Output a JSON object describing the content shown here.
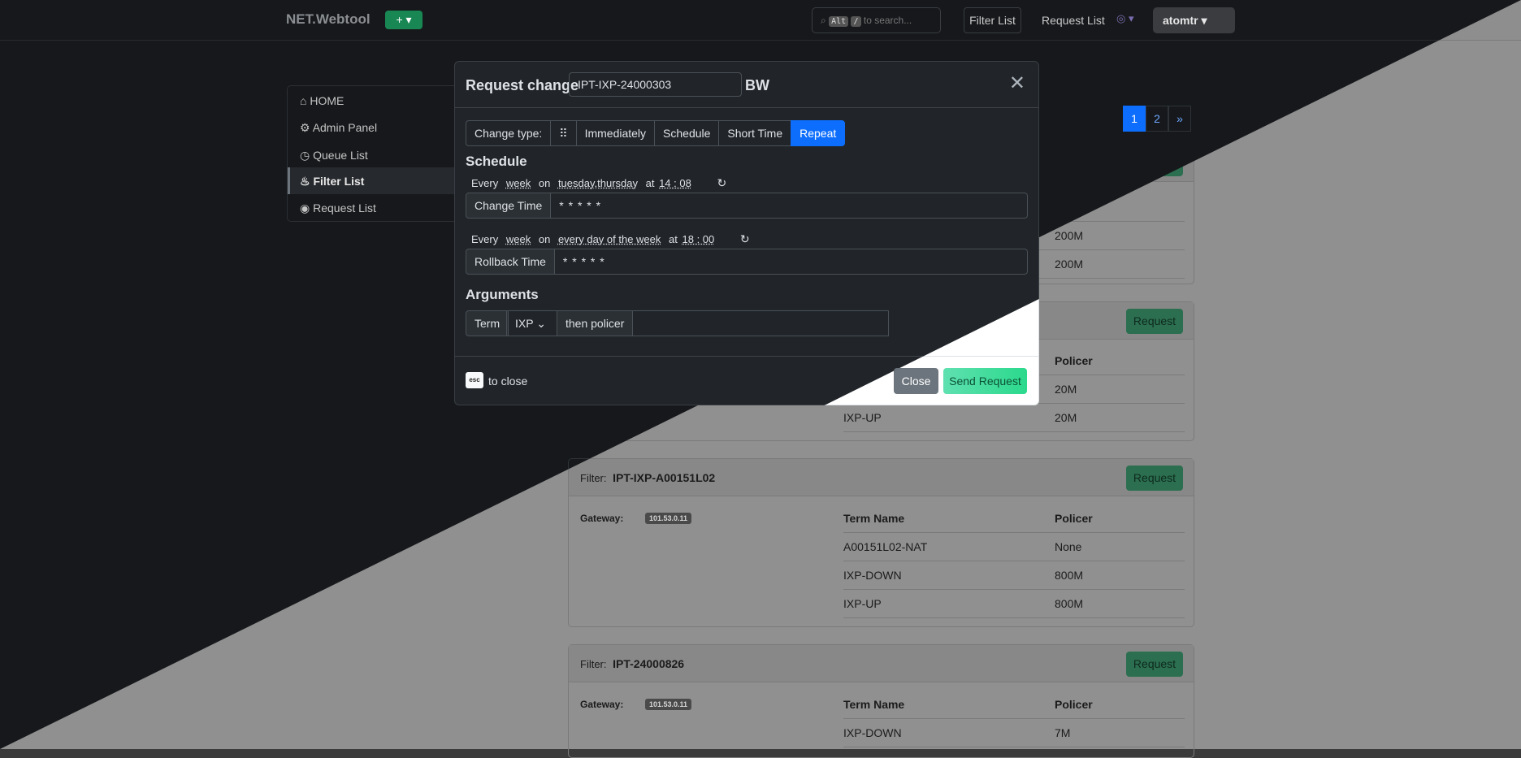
{
  "nav": {
    "brand": "NET.Webtool",
    "plus": "+ ▾",
    "search_placeholder": "to search...",
    "search_key1": "Alt",
    "search_key2": "/",
    "filter_list": "Filter List",
    "request_list": "Request List",
    "lang": "◎ ▾",
    "user": "atomtr ▾"
  },
  "sidebar": {
    "items": [
      {
        "icon": "⌂",
        "label": "HOME"
      },
      {
        "icon": "⚙",
        "label": "Admin Panel"
      },
      {
        "icon": "◷",
        "label": "Queue List"
      },
      {
        "icon": "♨",
        "label": "Filter List"
      },
      {
        "icon": "◉",
        "label": "Request List"
      }
    ]
  },
  "pager": [
    "1",
    "2",
    "»"
  ],
  "cards": {
    "request_label": "Request",
    "filter_prefix": "Filter:",
    "gateway_label": "Gateway:",
    "term_header": "Term Name",
    "policer_header": "Policer",
    "c1": {
      "rows": [
        {
          "term": "",
          "policer": "200M"
        },
        {
          "term": "",
          "policer": "200M"
        }
      ]
    },
    "c2": {
      "rows": [
        {
          "term": "",
          "policer": "20M"
        },
        {
          "term": "IXP-UP",
          "policer": "20M"
        }
      ]
    },
    "c3": {
      "filter": "IPT-IXP-A00151L02",
      "gateway": "101.53.0.11",
      "rows": [
        {
          "term": "A00151L02-NAT",
          "policer": "None"
        },
        {
          "term": "IXP-DOWN",
          "policer": "800M"
        },
        {
          "term": "IXP-UP",
          "policer": "800M"
        }
      ]
    },
    "c4": {
      "filter": "IPT-24000826",
      "gateway": "101.53.0.11",
      "rows": [
        {
          "term": "IXP-DOWN",
          "policer": "7M"
        }
      ]
    }
  },
  "modal": {
    "title": "Request change",
    "filter_value": "IPT-IXP-24000303",
    "suffix": "BW",
    "change_type_label": "Change type:",
    "drag_glyph": "⠿",
    "types": [
      "Immediately",
      "Schedule",
      "Short Time",
      "Repeat"
    ],
    "schedule_title": "Schedule",
    "change": {
      "every": "Every",
      "unit": "week",
      "on": "on",
      "days": "tuesday,thursday",
      "at": "at",
      "time": "14 : 08",
      "label": "Change Time",
      "value": "* * * * *"
    },
    "rollback": {
      "every": "Every",
      "unit": "week",
      "on": "on",
      "days": "every day of the week",
      "at": "at",
      "time": "18 : 00",
      "label": "Rollback Time",
      "value": "* * * * *"
    },
    "arguments_title": "Arguments",
    "args": {
      "term": "Term",
      "select": "IXP",
      "then": "then policer"
    },
    "esc_key": "esc",
    "esc_text": "to close",
    "close": "Close",
    "send": "Send Request"
  }
}
